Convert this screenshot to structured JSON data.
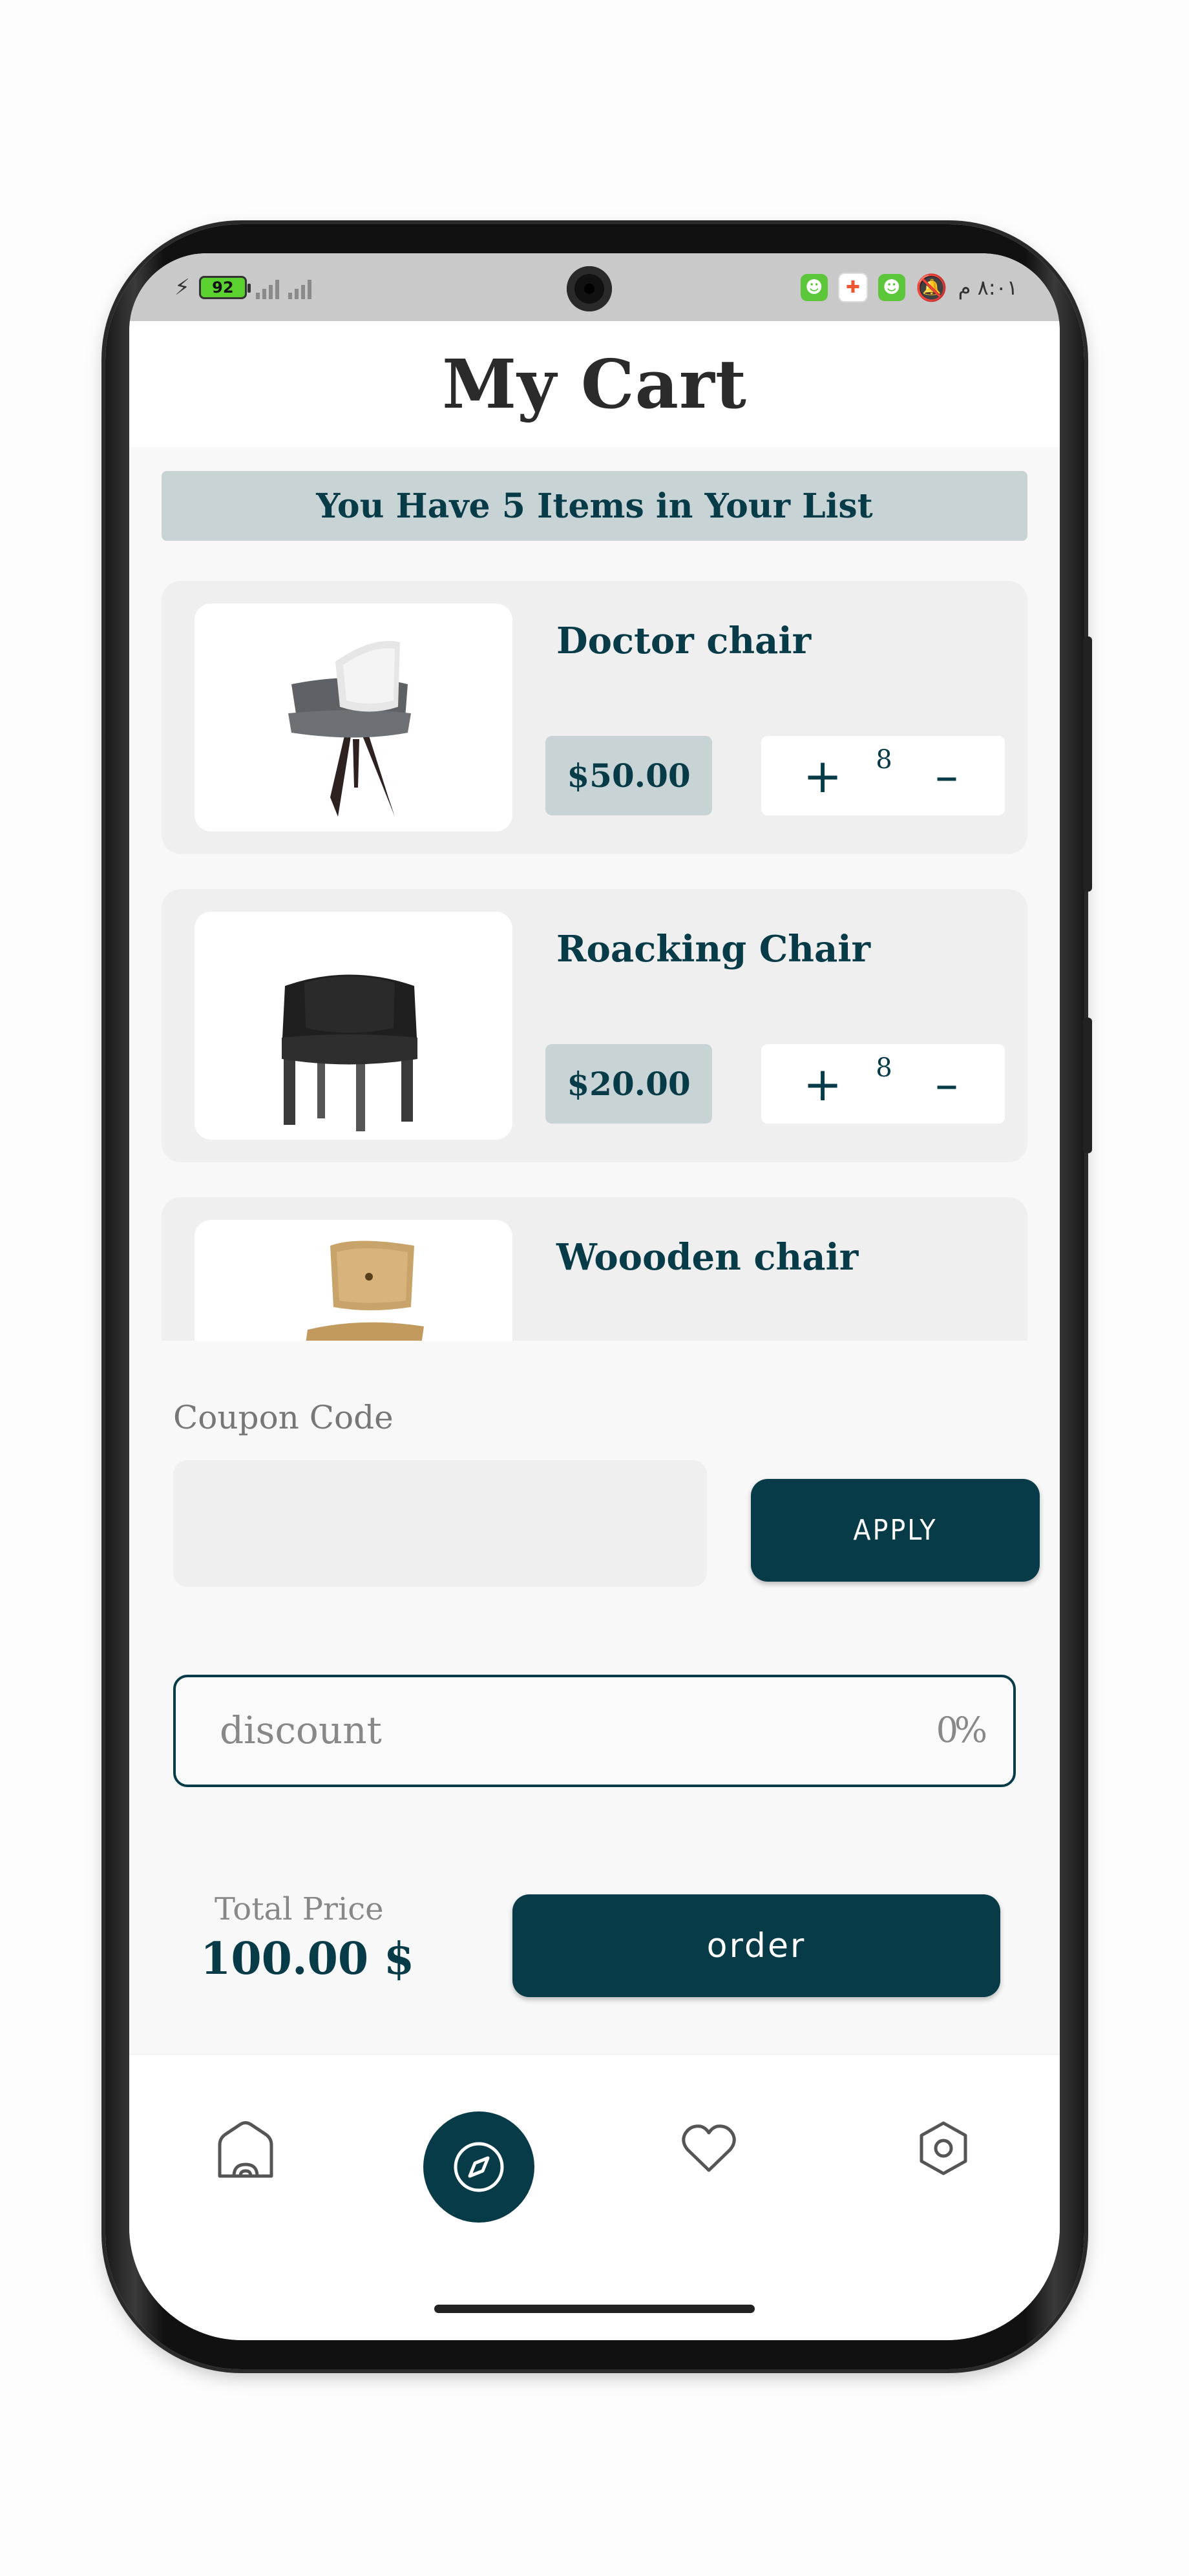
{
  "status_bar": {
    "battery": "92",
    "time": "٨:٠١ م"
  },
  "header": {
    "title": "My Cart"
  },
  "cart": {
    "items_banner": "You Have 5 Items in Your List",
    "items": [
      {
        "name": "Doctor chair",
        "price": "$50.00",
        "quantity": "8",
        "image_icon": "gray-armchair-with-pillow"
      },
      {
        "name": "Roacking Chair",
        "price": "$20.00",
        "quantity": "8",
        "image_icon": "black-armchair"
      },
      {
        "name": "Woooden chair",
        "price": "",
        "quantity": "",
        "image_icon": "wooden-chair"
      }
    ],
    "stepper": {
      "plus": "+",
      "minus": "–"
    }
  },
  "coupon": {
    "label": "Coupon Code",
    "value": "",
    "apply_label": "APPLY"
  },
  "discount": {
    "label": "discount",
    "value": "0",
    "unit": "%"
  },
  "total": {
    "label": "Total Price",
    "value": "100.00 $",
    "order_label": "order"
  },
  "bottom_nav": {
    "items": [
      "home-icon",
      "compass-icon",
      "heart-icon",
      "settings-icon"
    ],
    "active": "compass-icon"
  },
  "colors": {
    "primary": "#073b47",
    "banner": "#c8d3d5",
    "card": "#efefef",
    "title": "#2b2b2b"
  }
}
